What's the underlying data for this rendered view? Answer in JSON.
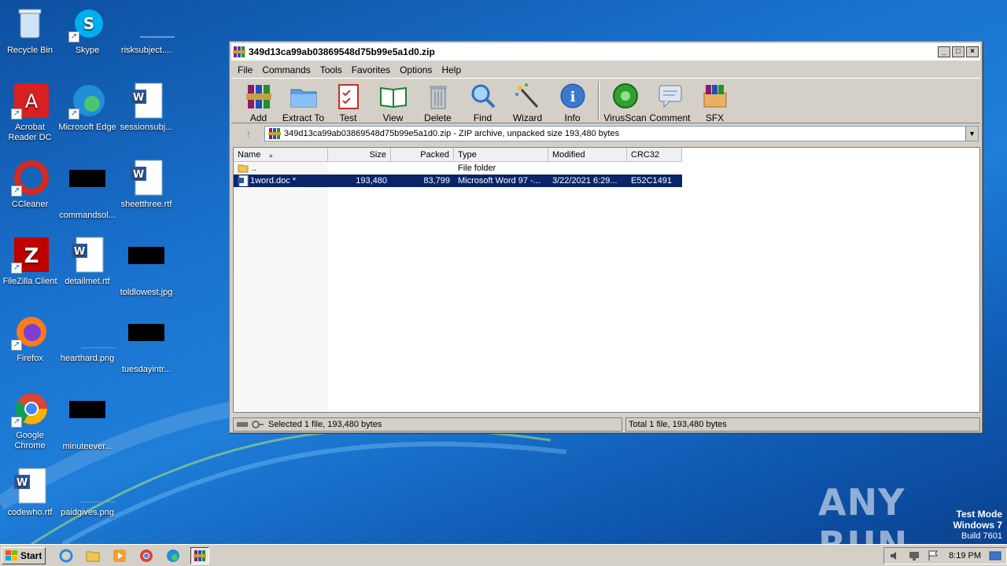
{
  "desktop": {
    "icons": [
      {
        "label": "Recycle Bin"
      },
      {
        "label": "Skype"
      },
      {
        "label": "risksubject...."
      },
      {
        "label": "Acrobat Reader DC"
      },
      {
        "label": "Microsoft Edge"
      },
      {
        "label": "sessionsubj..."
      },
      {
        "label": "CCleaner"
      },
      {
        "label": "commandsol..."
      },
      {
        "label": "sheetthree.rtf"
      },
      {
        "label": "FileZilla Client"
      },
      {
        "label": "detailmet.rtf"
      },
      {
        "label": "toldlowest.jpg"
      },
      {
        "label": "Firefox"
      },
      {
        "label": "hearthard.png"
      },
      {
        "label": "tuesdayintr..."
      },
      {
        "label": "Google Chrome"
      },
      {
        "label": "minuteever..."
      },
      {
        "label": "codewho.rtf"
      },
      {
        "label": "paidgives.png"
      }
    ]
  },
  "window": {
    "title": "349d13ca99ab03869548d75b99e5a1d0.zip",
    "controls": {
      "minimize": "_",
      "maximize": "□",
      "close": "×"
    },
    "menu": [
      "File",
      "Commands",
      "Tools",
      "Favorites",
      "Options",
      "Help"
    ],
    "toolbar": [
      "Add",
      "Extract To",
      "Test",
      "View",
      "Delete",
      "Find",
      "Wizard",
      "Info",
      "VirusScan",
      "Comment",
      "SFX"
    ],
    "address": "349d13ca99ab03869548d75b99e5a1d0.zip - ZIP archive, unpacked size 193,480 bytes",
    "columns": [
      "Name",
      "Size",
      "Packed",
      "Type",
      "Modified",
      "CRC32"
    ],
    "rows": [
      {
        "name": "..",
        "size": "",
        "packed": "",
        "type": "File folder",
        "modified": "",
        "crc": ""
      },
      {
        "name": "1word.doc *",
        "size": "193,480",
        "packed": "83,799",
        "type": "Microsoft Word 97 -...",
        "modified": "3/22/2021 6:29...",
        "crc": "E52C1491"
      }
    ],
    "status_left": "Selected 1 file, 193,480 bytes",
    "status_right": "Total 1 file, 193,480 bytes"
  },
  "taskbar": {
    "start_label": "Start",
    "clock": "8:19 PM"
  },
  "watermark": {
    "brand": "ANY RUN",
    "line1": "Test Mode",
    "line2": "Windows 7",
    "line3": "Build 7601"
  },
  "colors": {
    "selection": "#0a246a",
    "desktop": "#1a73cf"
  }
}
